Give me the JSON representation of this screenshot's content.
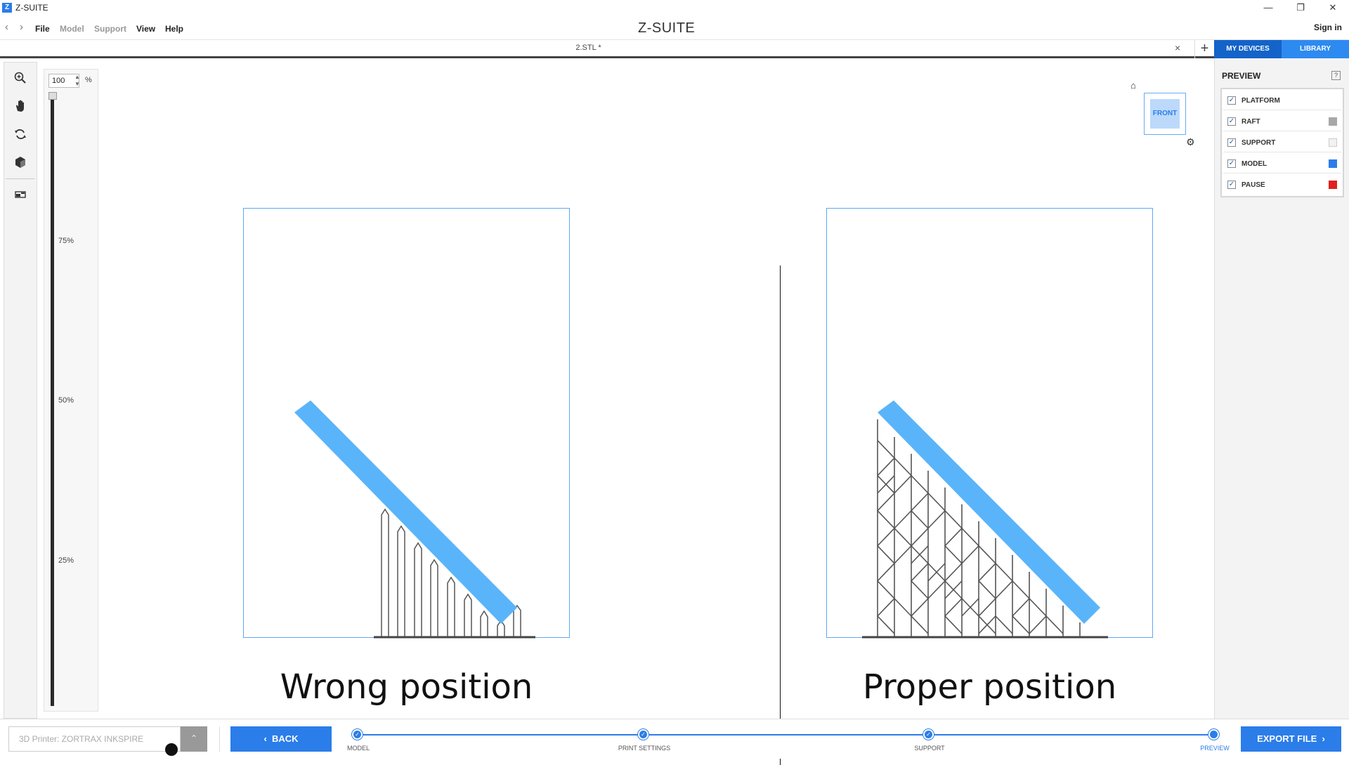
{
  "app": {
    "title": "Z-SUITE",
    "icon_letter": "Z",
    "logo": "Z-SUITE",
    "sign_in": "Sign in"
  },
  "menu": [
    "File",
    "Model",
    "Support",
    "View",
    "Help"
  ],
  "menu_disabled": [
    false,
    true,
    true,
    false,
    false
  ],
  "tab": {
    "name": "2.STL *",
    "close": "×",
    "add": "+"
  },
  "top_buttons": {
    "my_devices": "MY DEVICES",
    "library": "LIBRARY"
  },
  "left_tools": [
    "zoom-in-icon",
    "pan-hand-icon",
    "rotate-icon",
    "cube-view-icon",
    "layer-view-icon"
  ],
  "zoom": {
    "value": "100",
    "unit": "%",
    "ticks": [
      "75%",
      "50%",
      "25%"
    ]
  },
  "view_cube": {
    "face": "FRONT"
  },
  "canvas": {
    "left_caption": "Wrong position",
    "right_caption": "Proper position"
  },
  "preview": {
    "title": "PREVIEW",
    "help": "?",
    "layers": [
      {
        "label": "PLATFORM",
        "checked": true,
        "swatch": ""
      },
      {
        "label": "RAFT",
        "checked": true,
        "swatch": "#a8a8a8"
      },
      {
        "label": "SUPPORT",
        "checked": true,
        "swatch": "#f2f2f2"
      },
      {
        "label": "MODEL",
        "checked": true,
        "swatch": "#2b7de9"
      },
      {
        "label": "PAUSE",
        "checked": true,
        "swatch": "#e02020"
      }
    ]
  },
  "bottom": {
    "printer_placeholder": "3D Printer: ZORTRAX INKSPIRE",
    "back": "BACK",
    "export": "EXPORT FILE",
    "steps": [
      "MODEL",
      "PRINT SETTINGS",
      "SUPPORT",
      "PREVIEW"
    ],
    "active_step": 3
  },
  "colors": {
    "accent": "#2b7de9",
    "model": "#5ab4fa",
    "frame": "#5ea7f5"
  }
}
